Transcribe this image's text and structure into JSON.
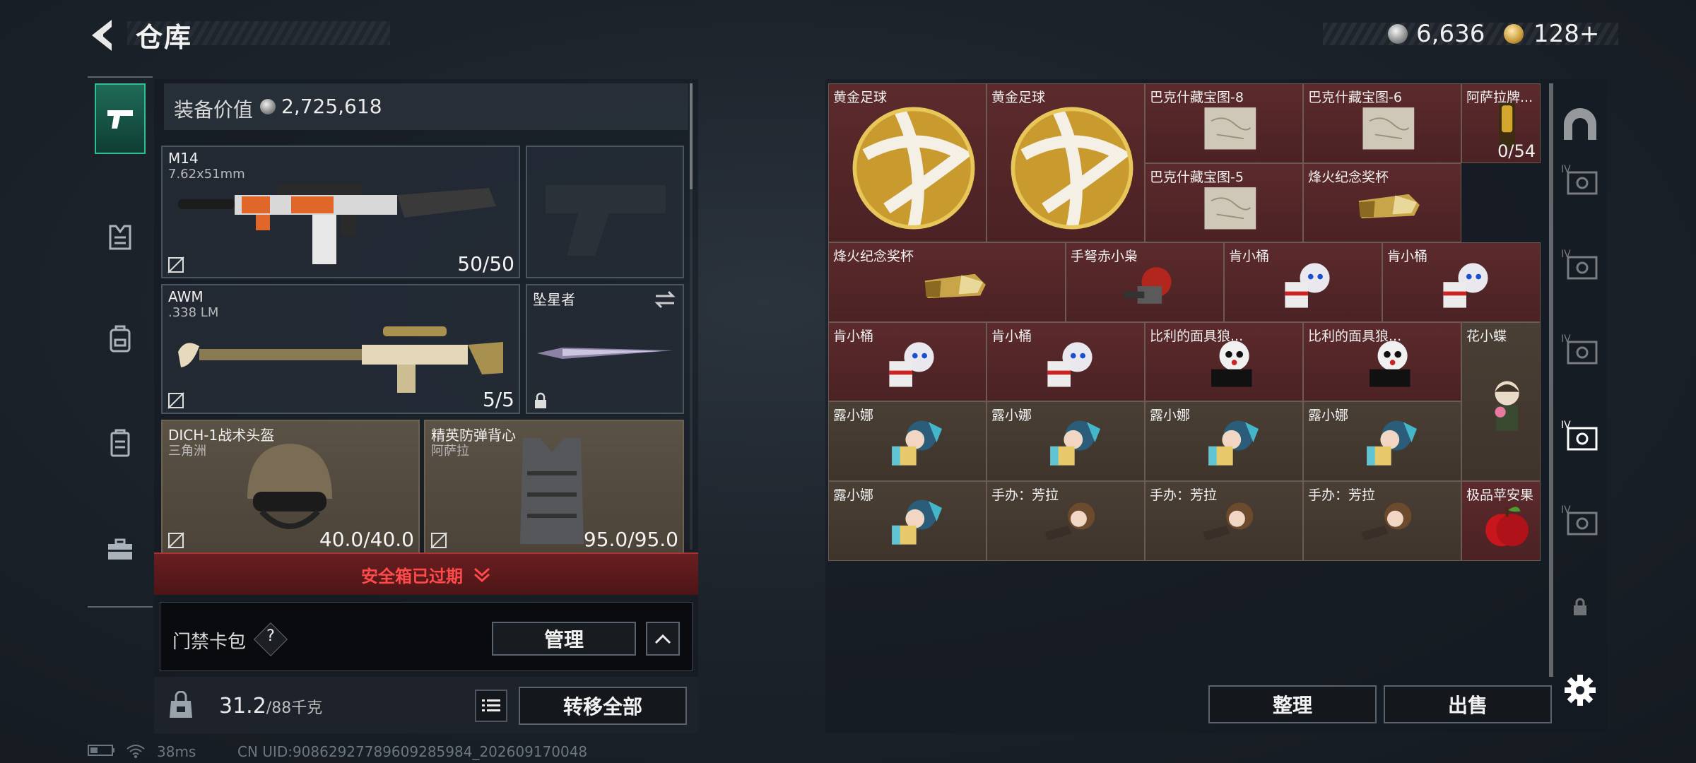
{
  "header": {
    "title": "仓库",
    "currency_silver": "6,636",
    "currency_gold": "128+"
  },
  "left_nav": {
    "items": [
      {
        "icon": "pistol-icon",
        "active": true
      },
      {
        "icon": "vest-icon",
        "active": false
      },
      {
        "icon": "backpack-icon",
        "active": false
      },
      {
        "icon": "chest-rig-icon",
        "active": false
      },
      {
        "icon": "briefcase-icon",
        "active": false
      }
    ]
  },
  "loadout": {
    "equip_value_label": "装备价值",
    "equip_value": "2,725,618",
    "slots": {
      "primary": {
        "name": "M14",
        "caliber": "7.62x51mm",
        "ammo": "50/50"
      },
      "secondary": {
        "name": "AWM",
        "caliber": ".338 LM",
        "ammo": "5/5"
      },
      "melee": {
        "name": "坠星者"
      },
      "helmet": {
        "name": "DICH-1战术头盔",
        "origin": "三角洲",
        "durability": "40.0/40.0"
      },
      "armor": {
        "name": "精英防弹背心",
        "origin": "阿萨拉",
        "durability": "95.0/95.0"
      }
    },
    "safebox_expired": "安全箱已过期",
    "keycard_label": "门禁卡包",
    "keycard_help": "?",
    "manage_label": "管理",
    "weight_current": "31.2",
    "weight_max": "/88千克",
    "transfer_all_label": "转移全部"
  },
  "status_bar": {
    "ping": "38ms",
    "uid": "CN UID:9086292778960928598​4_202609170048"
  },
  "stash": {
    "items": [
      {
        "name": "黄金足球",
        "kind": "gold-ball",
        "color": "red"
      },
      {
        "name": "黄金足球",
        "kind": "gold-ball",
        "color": "red"
      },
      {
        "name": "巴克什藏宝图-8",
        "kind": "map",
        "color": "red"
      },
      {
        "name": "巴克什藏宝图-6",
        "kind": "map",
        "color": "red"
      },
      {
        "name": "阿萨拉牌...",
        "kind": "lighter",
        "color": "red",
        "count": "0/54"
      },
      {
        "name": "巴克什藏宝图-5",
        "kind": "map",
        "color": "red"
      },
      {
        "name": "烽火纪念奖杯",
        "kind": "trophy",
        "color": "red"
      },
      {
        "name": "烽火纪念奖杯",
        "kind": "trophy",
        "color": "red"
      },
      {
        "name": "手弩赤小枭",
        "kind": "figure-red",
        "color": "red"
      },
      {
        "name": "肯小桶",
        "kind": "figure-white",
        "color": "red"
      },
      {
        "name": "肯小桶",
        "kind": "figure-white",
        "color": "red"
      },
      {
        "name": "肯小桶",
        "kind": "figure-white",
        "color": "red"
      },
      {
        "name": "肯小桶",
        "kind": "figure-white",
        "color": "red"
      },
      {
        "name": "比利的面具狼...",
        "kind": "figure-mask",
        "color": "red"
      },
      {
        "name": "比利的面具狼...",
        "kind": "figure-mask",
        "color": "red"
      },
      {
        "name": "花小蝶",
        "kind": "figure-green",
        "color": "brown"
      },
      {
        "name": "露小娜",
        "kind": "figure-teal",
        "color": "brown"
      },
      {
        "name": "露小娜",
        "kind": "figure-teal",
        "color": "brown"
      },
      {
        "name": "露小娜",
        "kind": "figure-teal",
        "color": "brown"
      },
      {
        "name": "露小娜",
        "kind": "figure-teal",
        "color": "brown"
      },
      {
        "name": "露小娜",
        "kind": "figure-teal",
        "color": "brown"
      },
      {
        "name": "手办：芳拉",
        "kind": "figure-brown",
        "color": "brown"
      },
      {
        "name": "手办：芳拉",
        "kind": "figure-brown",
        "color": "brown"
      },
      {
        "name": "手办：芳拉",
        "kind": "figure-brown",
        "color": "brown"
      },
      {
        "name": "极品苹安果",
        "kind": "apple",
        "color": "red"
      }
    ],
    "sort_label": "整理",
    "sell_label": "出售"
  },
  "right_tabs": [
    {
      "icon": "safe-dome-icon",
      "active": false
    },
    {
      "icon": "stash-tab-icon",
      "active": false
    },
    {
      "icon": "stash-tab-icon",
      "active": false
    },
    {
      "icon": "stash-tab-icon",
      "active": false
    },
    {
      "icon": "stash-tab-icon",
      "active": true
    },
    {
      "icon": "stash-tab-icon",
      "active": false
    },
    {
      "icon": "lock-icon",
      "active": false
    },
    {
      "icon": "gear-icon",
      "active": false
    }
  ],
  "colors": {
    "accent_green": "#2fbf94",
    "expired_red": "#ff4a4a",
    "cell_red": "#5c2a2c",
    "cell_brown": "#4a3f35"
  }
}
